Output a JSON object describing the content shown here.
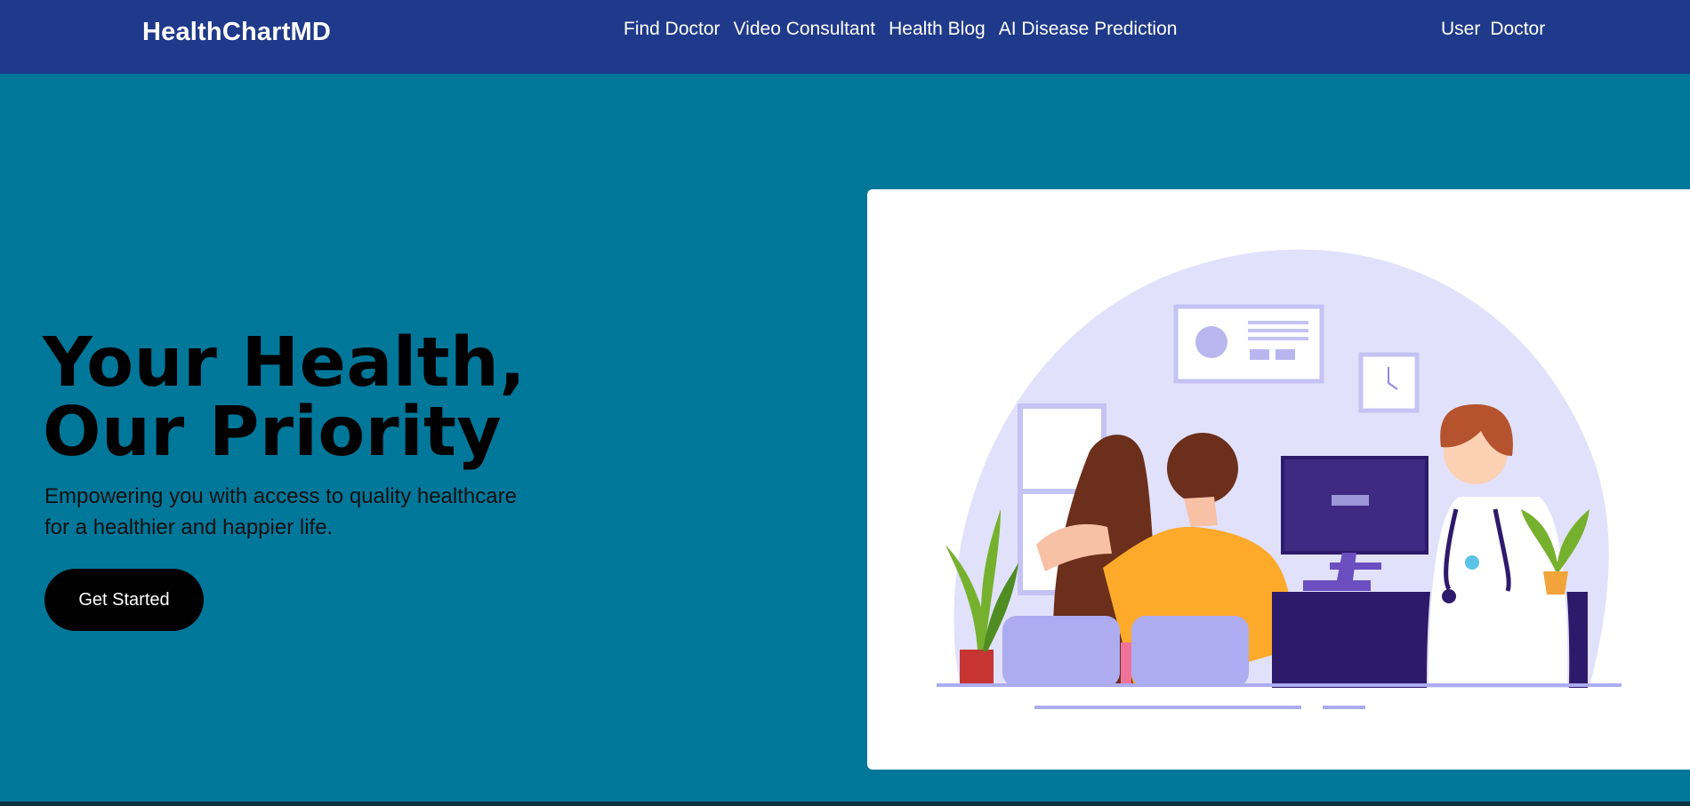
{
  "navbar": {
    "brand": "HealthChartMD",
    "links": [
      "Find Doctor",
      "Video Consultant",
      "Health Blog",
      "AI Disease Prediction"
    ],
    "right_links": [
      "User",
      "Doctor"
    ]
  },
  "hero": {
    "title": "Your Health, Our Priority",
    "subtitle_line1": "Empowering you with access to quality healthcare",
    "subtitle_line2": "for a healthier and happier life.",
    "cta_label": "Get Started"
  },
  "colors": {
    "navbar": "#1f3a8a",
    "hero_bg": "#01779a",
    "illustration_bg": "#ffffff",
    "illustration_circle": "#e1e1fb",
    "desk": "#2e1a6b",
    "chairs": "#adacf1"
  },
  "illustration": {
    "description_icon": "doctor-consultation-illustration"
  }
}
